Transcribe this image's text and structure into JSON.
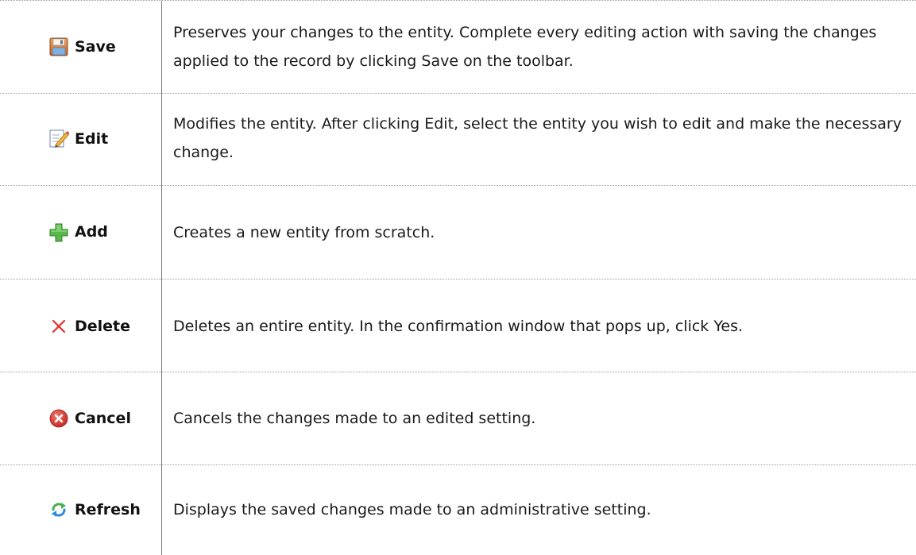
{
  "rows": [
    {
      "icon": "save-icon",
      "name": "Save",
      "description": "Preserves your changes to the entity. Complete every editing action with saving the changes applied to the record by clicking Save on the toolbar."
    },
    {
      "icon": "edit-icon",
      "name": "Edit",
      "description": "Modifies the entity. After clicking Edit, select the entity you wish to edit and make the necessary change."
    },
    {
      "icon": "add-icon",
      "name": "Add",
      "description": "Creates a new entity from scratch."
    },
    {
      "icon": "delete-icon",
      "name": "Delete",
      "description": "Deletes an entire entity. In the confirmation window that pops up, click Yes."
    },
    {
      "icon": "cancel-icon",
      "name": "Cancel",
      "description": "Cancels the changes made to an edited setting."
    },
    {
      "icon": "refresh-icon",
      "name": "Refresh",
      "description": "Displays the saved changes made to an administrative setting."
    }
  ],
  "colors": {
    "add_green": "#4caf3a",
    "delete_red": "#e0322a",
    "cancel_red": "#d93a3a",
    "refresh_green": "#4caf50",
    "refresh_blue": "#2a8be0"
  }
}
